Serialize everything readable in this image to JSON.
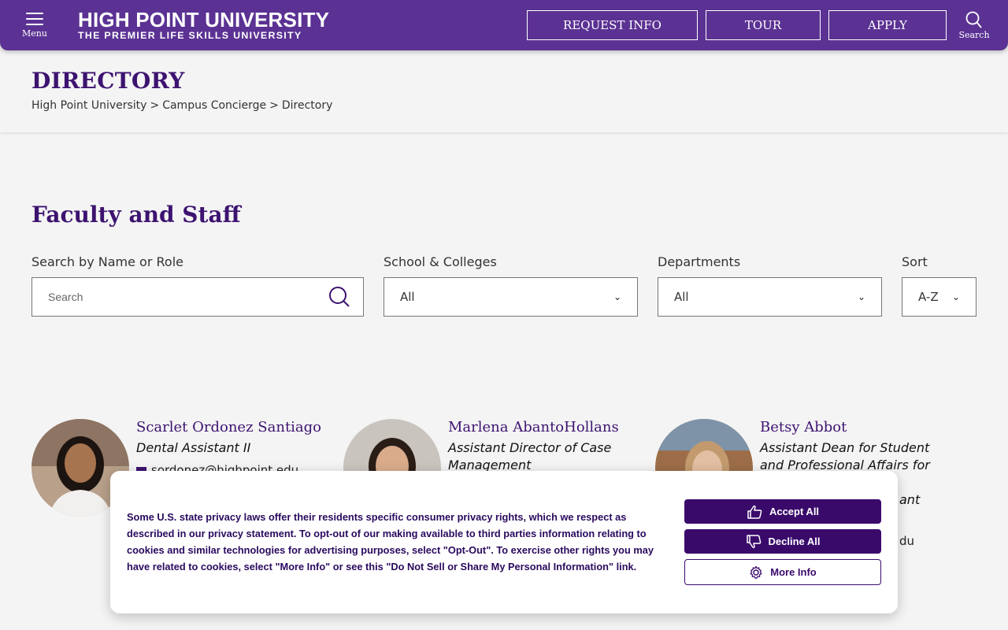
{
  "header": {
    "menu_label": "Menu",
    "brand_name": "HIGH POINT UNIVERSITY",
    "brand_tagline": "THE PREMIER LIFE SKILLS UNIVERSITY",
    "request_info": "REQUEST INFO",
    "tour": "TOUR",
    "apply": "APPLY",
    "search_label": "Search"
  },
  "page": {
    "title": "DIRECTORY",
    "breadcrumb": [
      "High Point University",
      "Campus Concierge",
      "Directory"
    ],
    "breadcrumb_sep": ">"
  },
  "directory": {
    "section_title": "Faculty and Staff",
    "search_label": "Search by Name or Role",
    "search_placeholder": "Search",
    "schools_label": "School & Colleges",
    "schools_value": "All",
    "departments_label": "Departments",
    "departments_value": "All",
    "sort_label": "Sort",
    "sort_value": "A-Z"
  },
  "people": [
    {
      "name": "Scarlet Ordonez Santiago",
      "role": "Dental Assistant II",
      "email": "sordonez@highpoint.edu"
    },
    {
      "name": "Marlena AbantoHollans",
      "role": "Assistant Director of Case Management",
      "email": ""
    },
    {
      "name": "Betsy Abbot",
      "role": "Assistant Dean for Student and Professional Affairs for",
      "role_tail": "ant",
      "email_tail": "du"
    }
  ],
  "cookie": {
    "text": "Some U.S. state privacy laws offer their residents specific consumer privacy rights, which we respect as described in our privacy statement. To opt-out of our making available to third parties information relating to cookies and similar technologies for advertising purposes, select \"Opt-Out\". To exercise other rights you may have related to cookies, select \"More Info\" or see this \"Do Not Sell or Share My Personal Information\" link.",
    "accept": "Accept All",
    "decline": "Decline All",
    "more": "More Info"
  },
  "colors": {
    "brand_purple": "#5b3293",
    "heading_purple": "#3d1370",
    "button_purple": "#3a0a6b"
  }
}
